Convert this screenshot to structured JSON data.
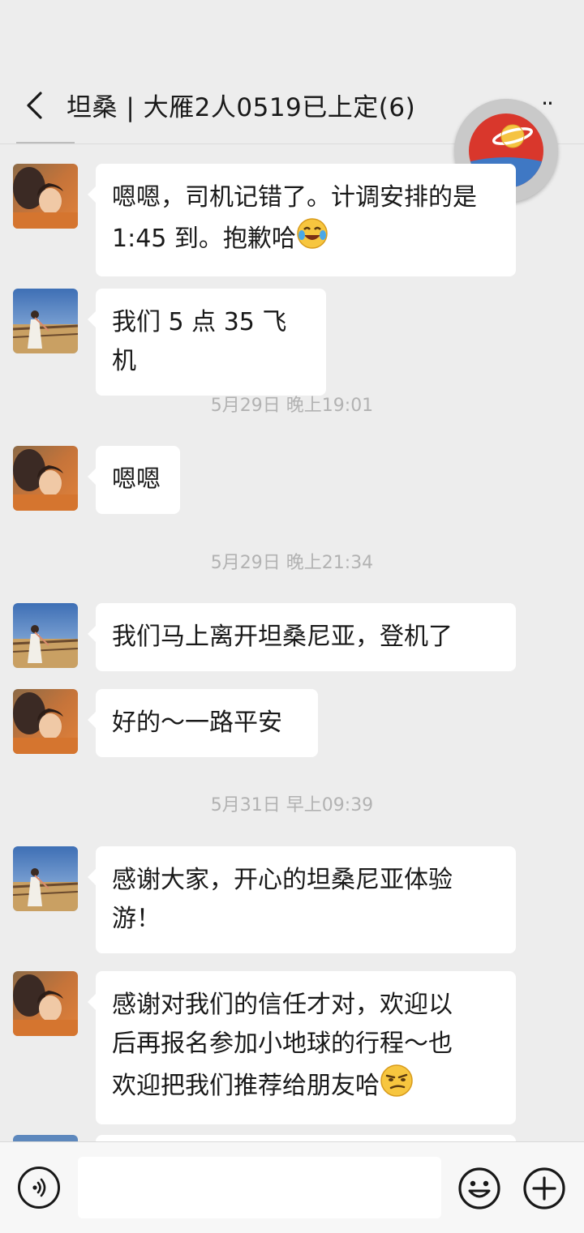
{
  "header": {
    "title": "坦桑 | 大雁2人0519已上定(6)",
    "back_icon": "chevron-left-icon",
    "more_icon": "ellipsis-icon",
    "more_glyph": "··"
  },
  "floating_logo": {
    "icon": "planet-logo-icon"
  },
  "messages": [
    {
      "sender": "guide",
      "lines": [
        "嗯嗯，司机记错了。计调安排的是",
        "1:45 到。抱歉哈"
      ],
      "emoji": "crying-laughing-emoji"
    },
    {
      "sender": "traveler",
      "lines": [
        "我们 5 点 35 飞机"
      ]
    },
    {
      "sender": "guide",
      "lines": [
        "嗯嗯"
      ]
    },
    {
      "sender": "traveler",
      "lines": [
        "我们马上离开坦桑尼亚，登机了"
      ]
    },
    {
      "sender": "guide",
      "lines": [
        "好的～一路平安"
      ]
    },
    {
      "sender": "traveler",
      "lines": [
        "感谢大家，开心的坦桑尼亚体验",
        "游！"
      ]
    },
    {
      "sender": "guide",
      "lines": [
        "感谢对我们的信任才对，欢迎以",
        "后再报名参加小地球的行程～也",
        "欢迎把我们推荐给朋友哈"
      ],
      "emoji": "smirk-emoji"
    }
  ],
  "timestamps": [
    "5月29日 晚上19:01",
    "5月29日 晚上21:34",
    "5月31日 早上09:39"
  ],
  "input_bar": {
    "voice_icon": "voice-icon",
    "input_placeholder": "",
    "emoji_icon": "emoji-face-icon",
    "plus_icon": "plus-circle-icon"
  },
  "colors": {
    "background": "#ededed",
    "bubble": "#ffffff",
    "timestamp": "#b2b2b2",
    "text": "#191919"
  }
}
